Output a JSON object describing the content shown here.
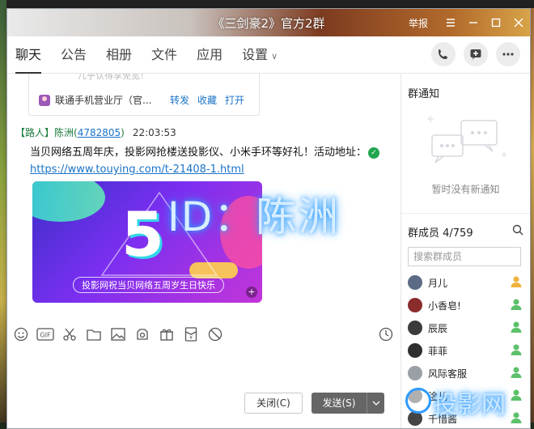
{
  "desktop": {
    "top_text": "[三剑豪2] 官方2群"
  },
  "window": {
    "title": "《三剑豪2》官方2群",
    "report_label": "举报"
  },
  "tabs": [
    {
      "label": "聊天"
    },
    {
      "label": "公告"
    },
    {
      "label": "相册"
    },
    {
      "label": "文件"
    },
    {
      "label": "应用"
    },
    {
      "label": "设置"
    }
  ],
  "chat": {
    "card": {
      "faded_text": "几乎认得享免宽！",
      "source": "联通手机营业厅（官...",
      "links": [
        "转发",
        "收藏",
        "打开"
      ]
    },
    "message": {
      "role": "【路人】",
      "sender": "陈洲",
      "qq": "4782805",
      "time": "22:03:53",
      "text": "当贝网络五周年庆，投影网抢楼送投影仪、小米手环等好礼！活动地址：",
      "link": "https://www.touying.com/t-21408-1.html",
      "image_number": "5",
      "image_caption": "投影网祝当贝网络五周岁生日快乐"
    },
    "overlay": "ID：陈洲"
  },
  "composer": {
    "close_label": "关闭(C)",
    "send_label": "发送(S)"
  },
  "sidebar": {
    "notice_title": "群通知",
    "notice_empty": "暂时没有新通知",
    "members_title": "群成员 4/759",
    "search_placeholder": "搜索群成员",
    "members": [
      {
        "name": "月儿",
        "color": "#5b6b86"
      },
      {
        "name": "小香皂!",
        "color": "#8a2c2c"
      },
      {
        "name": "辰辰",
        "color": "#3b3b3b"
      },
      {
        "name": "菲菲",
        "color": "#2f2f2f"
      },
      {
        "name": "风际客服",
        "color": "#9aa0a6"
      },
      {
        "name": "淦儿",
        "color": "#b0b0b0"
      },
      {
        "name": "千惜酱",
        "color": "#444444"
      }
    ]
  },
  "watermark": "投影网"
}
